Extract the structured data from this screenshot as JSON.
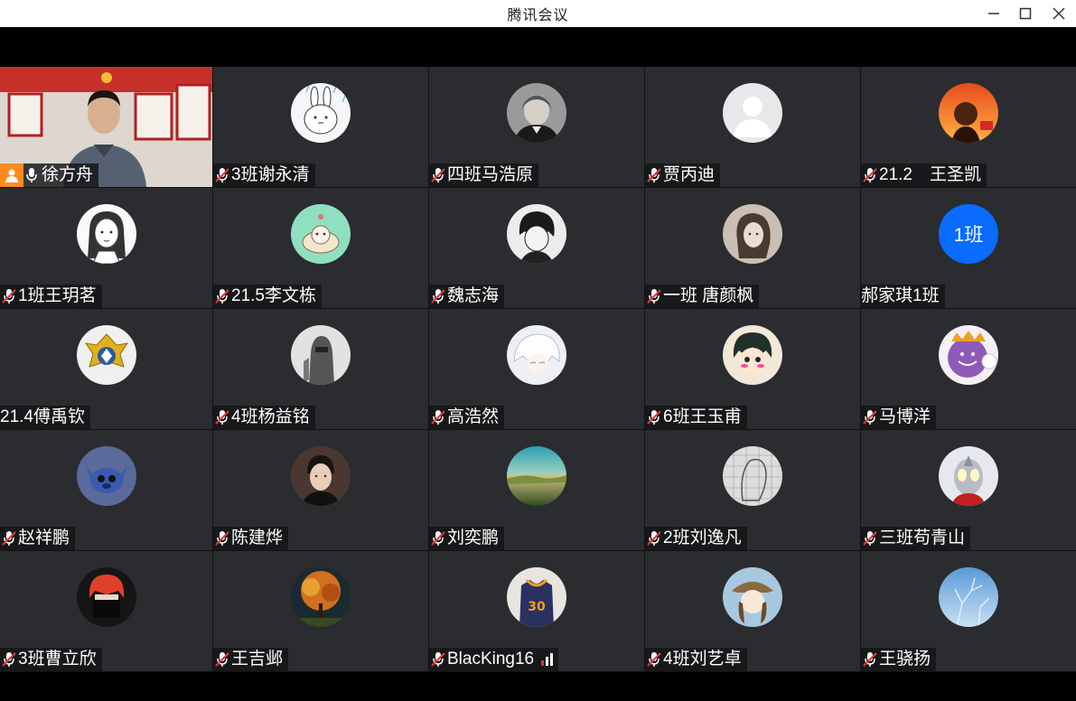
{
  "window": {
    "title": "腾讯会议"
  },
  "participants": [
    {
      "name": "徐方舟",
      "avatar": "camera-video",
      "mic": "on",
      "host": true
    },
    {
      "name": "3班谢永清",
      "avatar": "rabbit-avatar",
      "mic": "muted"
    },
    {
      "name": "四班马浩原",
      "avatar": "portrait-photo-avatar",
      "mic": "muted"
    },
    {
      "name": "贾丙迪",
      "avatar": "default-person-avatar",
      "mic": "muted"
    },
    {
      "name": "21.2　王圣凯",
      "avatar": "sunset-boy-avatar",
      "mic": "muted"
    },
    {
      "name": "1班王玥茗",
      "avatar": "sketch-girl-avatar",
      "mic": "muted"
    },
    {
      "name": "21.5李文栋",
      "avatar": "shell-cartoon-avatar",
      "mic": "muted"
    },
    {
      "name": "魏志海",
      "avatar": "anime-boy-avatar",
      "mic": "muted"
    },
    {
      "name": "一班 唐颜枫",
      "avatar": "sepia-girl-avatar",
      "mic": "muted"
    },
    {
      "name": "郝家琪1班",
      "avatar": "text-avatar",
      "avatar_text": "1班",
      "mic": "none"
    },
    {
      "name": "21.4傅禹钦",
      "avatar": "emblem-avatar",
      "mic": "none"
    },
    {
      "name": "4班杨益铭",
      "avatar": "knight-avatar",
      "mic": "muted"
    },
    {
      "name": "高浩然",
      "avatar": "white-hair-anime-avatar",
      "mic": "muted"
    },
    {
      "name": "6班王玉甫",
      "avatar": "blushing-anime-avatar",
      "mic": "muted"
    },
    {
      "name": "马博洋",
      "avatar": "purple-monster-avatar",
      "mic": "muted"
    },
    {
      "name": "赵祥鹏",
      "avatar": "stitch-avatar",
      "mic": "muted"
    },
    {
      "name": "陈建烨",
      "avatar": "young-man-photo-avatar",
      "mic": "muted"
    },
    {
      "name": "刘奕鹏",
      "avatar": "landscape-avatar",
      "mic": "muted"
    },
    {
      "name": "2班刘逸凡",
      "avatar": "sketch-head-avatar",
      "mic": "muted"
    },
    {
      "name": "三班苟青山",
      "avatar": "ultraman-avatar",
      "mic": "muted"
    },
    {
      "name": "3班曹立欣",
      "avatar": "masked-red-hair-avatar",
      "mic": "muted"
    },
    {
      "name": "王吉邺",
      "avatar": "autumn-tree-avatar",
      "mic": "muted"
    },
    {
      "name": "BlacKing16",
      "avatar": "jersey-30-avatar",
      "mic": "muted",
      "signal": true
    },
    {
      "name": "4班刘艺卓",
      "avatar": "hat-girl-avatar",
      "mic": "muted"
    },
    {
      "name": "王骁扬",
      "avatar": "sky-tree-avatar",
      "mic": "muted"
    }
  ],
  "colors": {
    "tile_bg": "#2b2c30",
    "muted_red": "#e0383e",
    "text_avatar_blue": "#0a6bff",
    "host_orange": "#ff8a1f"
  }
}
